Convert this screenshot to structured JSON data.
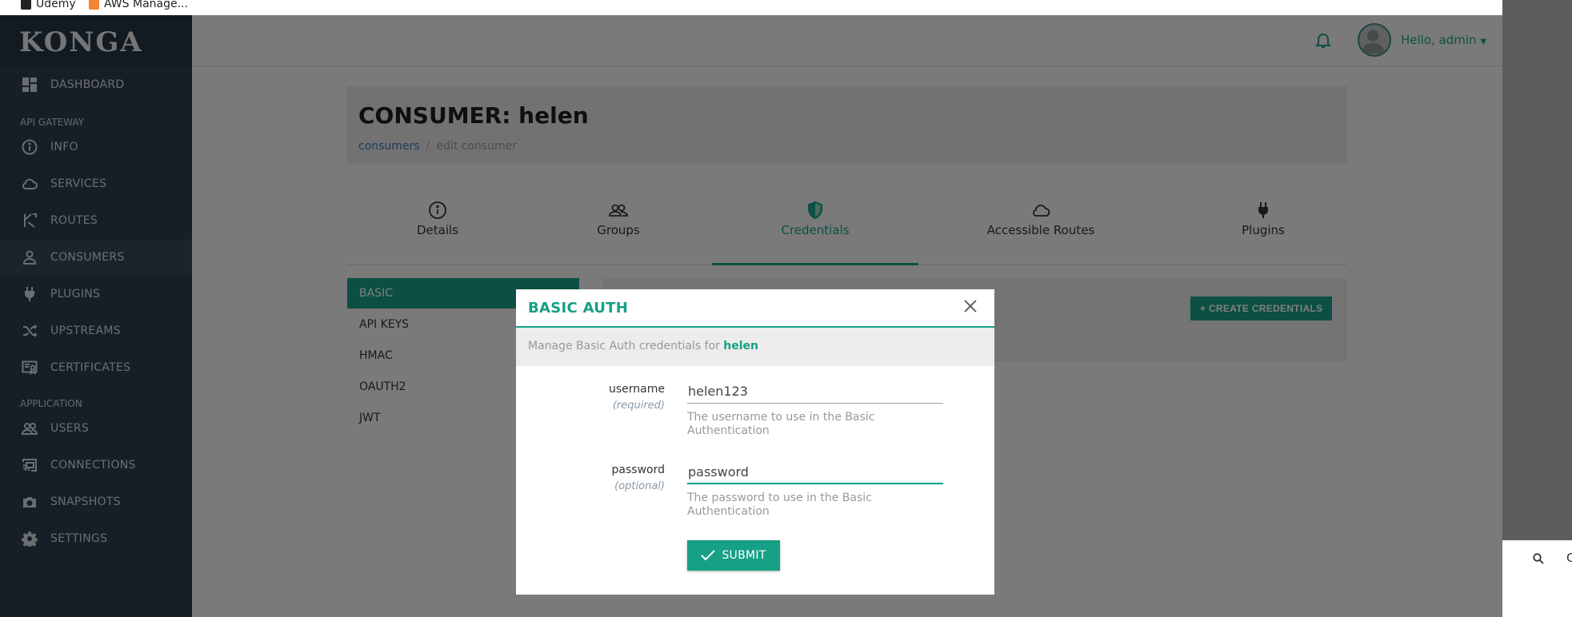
{
  "bookmarks": [
    {
      "label": "Udemy",
      "color": "#a435f0"
    },
    {
      "label": "AWS Manage...",
      "color": "#f58534"
    }
  ],
  "sidebar": {
    "logo": "KONGA",
    "dashboard_label": "DASHBOARD",
    "section_api": "API GATEWAY",
    "api_items": [
      {
        "label": "INFO",
        "icon": "info-icon"
      },
      {
        "label": "SERVICES",
        "icon": "cloud-icon"
      },
      {
        "label": "ROUTES",
        "icon": "routes-icon"
      },
      {
        "label": "CONSUMERS",
        "icon": "user-icon"
      },
      {
        "label": "PLUGINS",
        "icon": "plug-icon"
      },
      {
        "label": "UPSTREAMS",
        "icon": "shuffle-icon"
      },
      {
        "label": "CERTIFICATES",
        "icon": "certificate-icon"
      }
    ],
    "section_app": "APPLICATION",
    "app_items": [
      {
        "label": "USERS",
        "icon": "users-icon"
      },
      {
        "label": "CONNECTIONS",
        "icon": "cast-icon"
      },
      {
        "label": "SNAPSHOTS",
        "icon": "camera-icon"
      },
      {
        "label": "SETTINGS",
        "icon": "gear-icon"
      }
    ]
  },
  "topbar": {
    "greeting": "Hello, admin"
  },
  "consumer": {
    "title": "CONSUMER: helen",
    "breadcrumb_link": "consumers",
    "breadcrumb_sep": "/",
    "breadcrumb_current": "edit consumer"
  },
  "tabs": [
    {
      "label": "Details",
      "icon": "info-icon"
    },
    {
      "label": "Groups",
      "icon": "users-icon"
    },
    {
      "label": "Credentials",
      "icon": "shield-icon"
    },
    {
      "label": "Accessible Routes",
      "icon": "cloud-icon"
    },
    {
      "label": "Plugins",
      "icon": "plug-icon"
    }
  ],
  "active_tab": "Credentials",
  "credential_types": [
    "BASIC",
    "API KEYS",
    "HMAC",
    "OAUTH2",
    "JWT"
  ],
  "create_button": "CREATE CREDENTIALS",
  "modal": {
    "title": "BASIC AUTH",
    "subtitle": "Manage Basic Auth credentials for",
    "subtitle_user": "helen",
    "username_label": "username",
    "username_note": "(required)",
    "username_value": "helen123",
    "username_help": "The username to use in the Basic Authentication",
    "password_label": "password",
    "password_note": "(optional)",
    "password_value": "password",
    "password_help": "The password to use in the Basic Authentication",
    "submit_label": "SUBMIT"
  },
  "right_strip": {
    "search_text": "C"
  },
  "colors": {
    "accent": "#16a085",
    "sidebar": "#2c3e50",
    "link": "#3d77b8"
  }
}
